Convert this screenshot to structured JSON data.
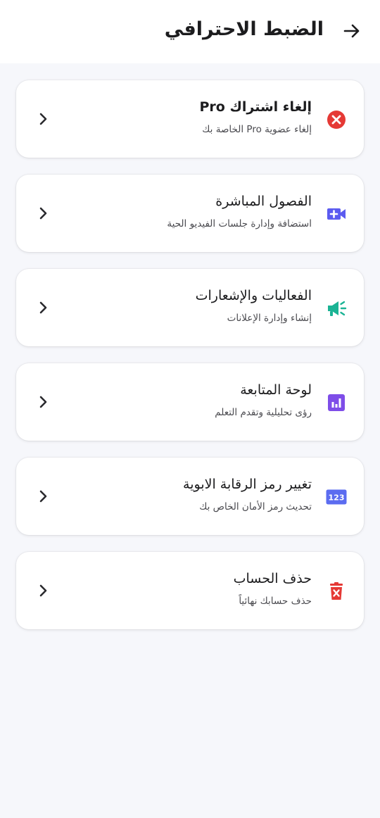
{
  "header": {
    "title": "الضبط الاحترافي",
    "back_icon": "arrow-right-icon"
  },
  "items": [
    {
      "title": "إلغاء اشتراك Pro",
      "subtitle": "إلغاء عضوية Pro الخاصة بك",
      "icon": "cancel-circle-icon",
      "icon_color": "#e53935"
    },
    {
      "title": "الفصول المباشرة",
      "subtitle": "استضافة وإدارة جلسات الفيديو الحية",
      "icon": "video-add-icon",
      "icon_color": "#5b5bf0"
    },
    {
      "title": "الفعاليات والإشعارات",
      "subtitle": "إنشاء وإدارة الإعلانات",
      "icon": "megaphone-icon",
      "icon_color": "#1ab394"
    },
    {
      "title": "لوحة المتابعة",
      "subtitle": "رؤى تحليلية وتقدم التعلم",
      "icon": "analytics-chart-icon",
      "icon_color": "#7e4de8"
    },
    {
      "title": "تغيير رمز الرقابة الابوية",
      "subtitle": "تحديث رمز الأمان الخاص بك",
      "icon": "pin-123-icon",
      "icon_label": "123",
      "icon_color": "#5b6cf0"
    },
    {
      "title": "حذف الحساب",
      "subtitle": "حذف حسابك نهائياً",
      "icon": "delete-icon",
      "icon_color": "#e53935"
    }
  ],
  "chevron_icon": "chevron-right-icon"
}
